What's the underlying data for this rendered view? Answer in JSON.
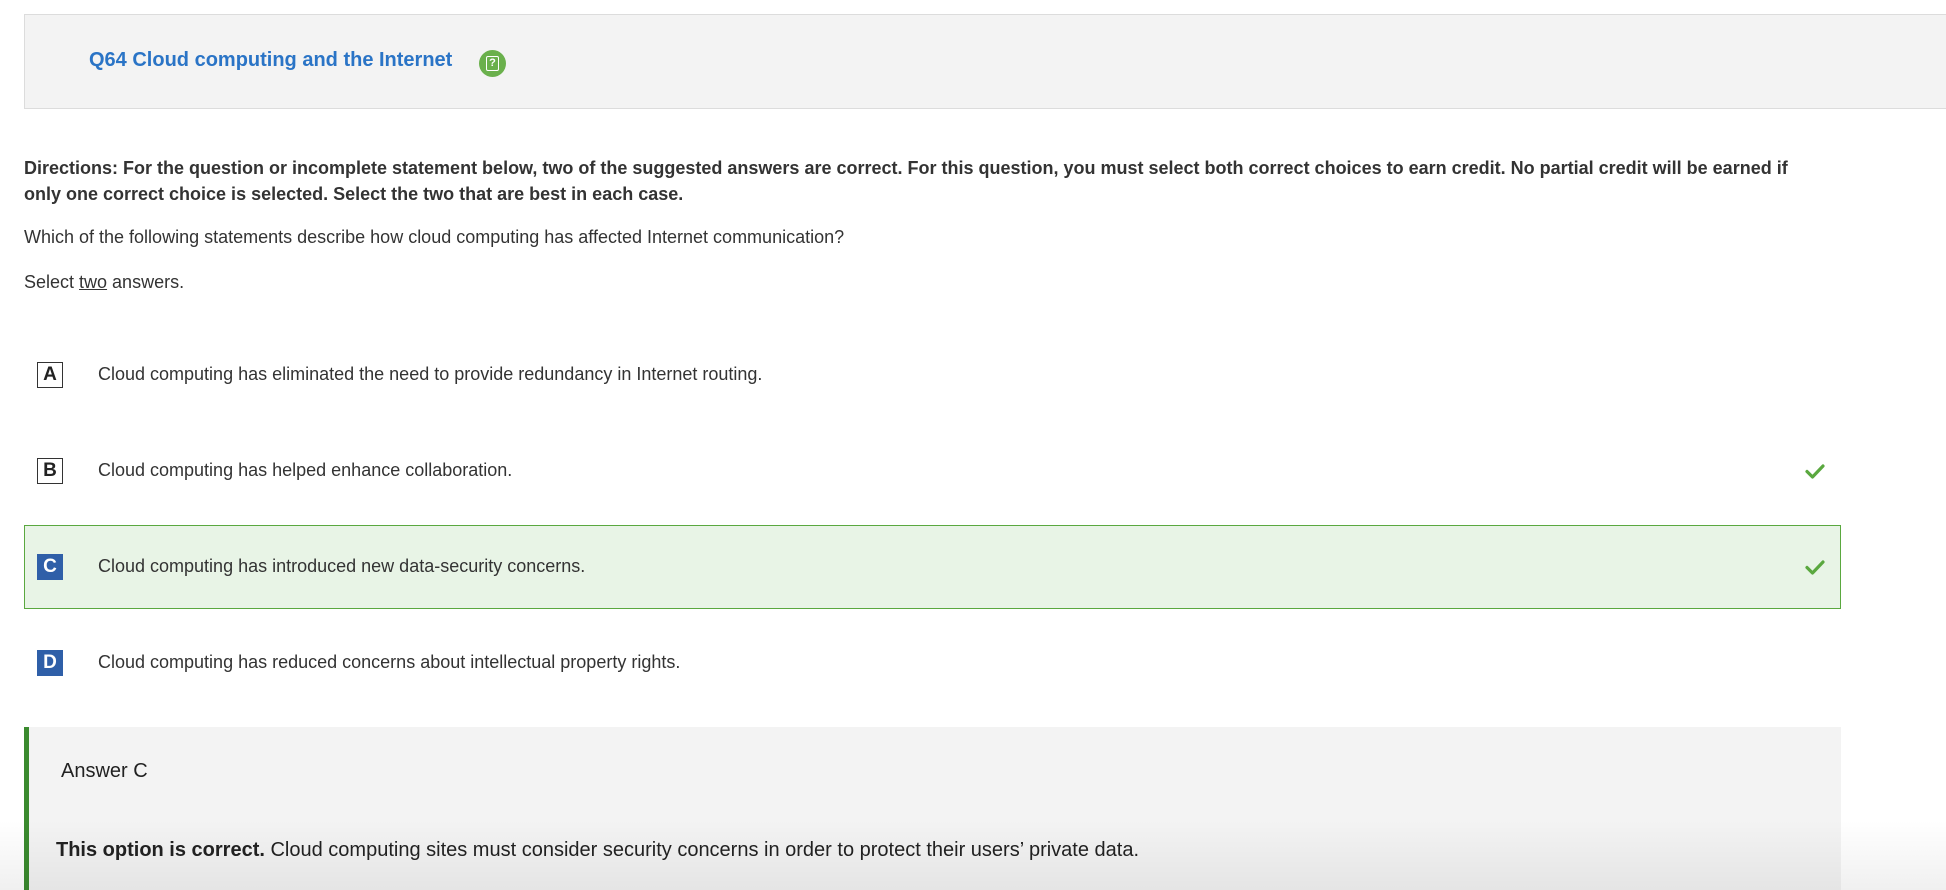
{
  "header": {
    "title": "Q64 Cloud computing and the Internet",
    "help_icon": "question-mark-icon",
    "title_color": "#2a74c6"
  },
  "directions": "Directions: For the question or incomplete statement below, two of the suggested answers are correct. For this question, you must select both correct choices to earn credit. No partial credit will be earned if only one correct choice is selected. Select the two that are best in each case.",
  "question": "Which of the following statements describe how cloud computing has affected Internet communication?",
  "instruction": {
    "prefix": "Select ",
    "emphasis": "two",
    "suffix": " answers."
  },
  "options": [
    {
      "letter": "A",
      "text": "Cloud computing has eliminated the need to provide redundancy in Internet routing.",
      "letter_filled": false,
      "highlighted": false,
      "correct_mark": false
    },
    {
      "letter": "B",
      "text": "Cloud computing has helped enhance collaboration.",
      "letter_filled": false,
      "highlighted": false,
      "correct_mark": true
    },
    {
      "letter": "C",
      "text": "Cloud computing has introduced new data-security concerns.",
      "letter_filled": true,
      "highlighted": true,
      "correct_mark": true
    },
    {
      "letter": "D",
      "text": "Cloud computing has reduced concerns about intellectual property rights.",
      "letter_filled": true,
      "highlighted": false,
      "correct_mark": false
    }
  ],
  "answer": {
    "title": "Answer C",
    "explanation_bold": "This option is correct.",
    "explanation_text": " Cloud computing sites must consider security concerns in order to protect their users’ private data."
  },
  "colors": {
    "accent_green": "#5aa83f",
    "selected_bg": "#e8f4e6",
    "letter_fill": "#2f5fa8",
    "answer_border": "#3a8a2e"
  }
}
